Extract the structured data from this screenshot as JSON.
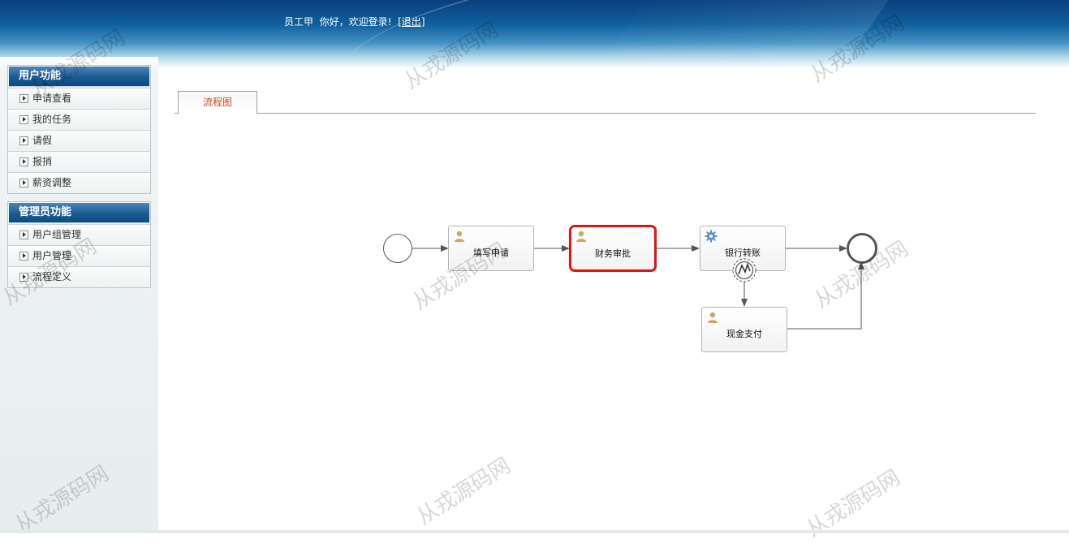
{
  "header": {
    "user_name": "员工甲",
    "welcome": "你好，欢迎登录!",
    "bracket_open": "[",
    "logout": "退出",
    "bracket_close": "]"
  },
  "sidebar": {
    "user_section": {
      "title": "用户功能",
      "items": [
        {
          "label": "申请查看"
        },
        {
          "label": "我的任务"
        },
        {
          "label": "请假"
        },
        {
          "label": "报捎"
        },
        {
          "label": "薪资调整"
        }
      ]
    },
    "admin_section": {
      "title": "管理员功能",
      "items": [
        {
          "label": "用户组管理"
        },
        {
          "label": "用户管理"
        },
        {
          "label": "流程定义"
        }
      ]
    }
  },
  "tabs": [
    {
      "label": "流程图"
    }
  ],
  "flow": {
    "nodes": {
      "fill_application": "填写申请",
      "finance_approval": "财务审批",
      "bank_transfer": "银行转账",
      "cash_payment": "现金支付"
    },
    "active_node": "财务审批",
    "colors": {
      "active_border": "#e3140f",
      "line": "#555555"
    }
  },
  "watermark": "从戎源码网"
}
